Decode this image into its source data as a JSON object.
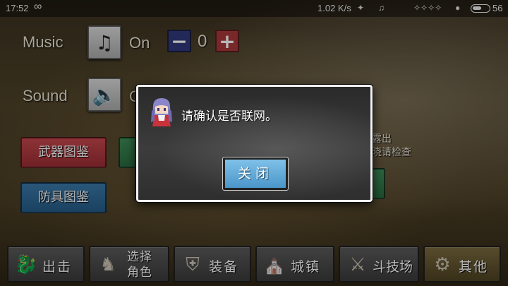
{
  "statusbar": {
    "time": "17:52",
    "loop_glyph": "∞",
    "speed": "1.02 K/s",
    "battery": "56"
  },
  "settings": {
    "music_label": "Music",
    "music_state": "On",
    "music_volume": "0",
    "minus_glyph": "−",
    "plus_glyph": "+",
    "sound_label": "Sound",
    "sound_state_partial": "O"
  },
  "menu": {
    "weapons_book": "武器图鉴",
    "armor_book": "防具图鉴",
    "partial_note_1": "露出",
    "partial_note_2": "晓请检查"
  },
  "nav": {
    "sortie": "出击",
    "select_char_line1": "选择",
    "select_char_line2": "角色",
    "equipment": "装备",
    "town": "城镇",
    "arena": "斗技场",
    "other": "其他"
  },
  "dialog": {
    "message": "请确认是否联网。",
    "close_label": "关闭"
  },
  "colors": {
    "red_button": "#b13a40",
    "blue_button": "#3070a0",
    "close_button": "#5aa8d8",
    "plus_button": "#a8383a",
    "minus_button": "#303a7a"
  }
}
